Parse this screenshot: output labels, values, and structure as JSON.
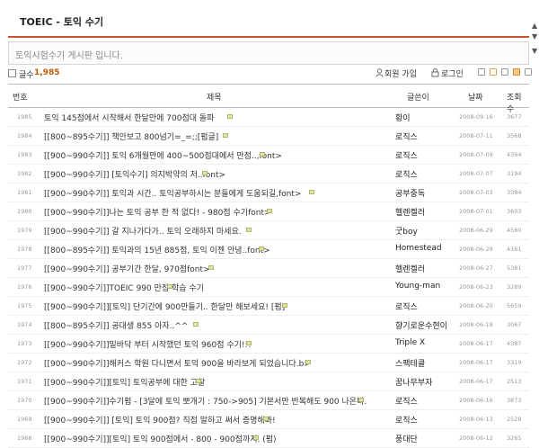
{
  "board": {
    "title": "TOEIC - 토익 수기",
    "description": "토익시험수기 게시판 입니다.",
    "count_label": "글수",
    "count_value": "1,985",
    "join_label": "회원 가입",
    "login_label": "로그인"
  },
  "header": {
    "no": "번호",
    "title": "제목",
    "author": "글쓴이",
    "date": "날짜",
    "views": "조회 수"
  },
  "rows": [
    {
      "no": "1985",
      "title": "토익 145점에서 시작해서 한달만에 700점대 돌파",
      "author": "황이",
      "date": "2008-09-16",
      "views": "3677"
    },
    {
      "no": "1984",
      "title": "[[800~895수기]] 책안보고 800넘기=_=;;[펌글]",
      "author": "로직스",
      "date": "2008-07-11",
      "views": "3568"
    },
    {
      "no": "1983",
      "title": "[[900~990수기]] 토익 6개월만에 400~500점대에서 만점..,font>",
      "author": "로직스",
      "date": "2008-07-09",
      "views": "4394"
    },
    {
      "no": "1982",
      "title": "[[900~990수기]] [토익수기] 의지박약의 저..font>",
      "author": "로직스",
      "date": "2008-07-07",
      "views": "3194"
    },
    {
      "no": "1981",
      "title": "[[900~990수기]] 토익과 시간.. 토익공부하시는 분들에게 도움되길,font>",
      "author": "공부중독",
      "date": "2008-07-03",
      "views": "3384"
    },
    {
      "no": "1980",
      "title": "[[900~990수기]]나는 토익 공부 한 적 없다! - 980점 수기font>",
      "author": "헬렌켈러",
      "date": "2008-07-01",
      "views": "3603"
    },
    {
      "no": "1979",
      "title": "[[900~990수기]] 갈 지나가다가.. 토익 오래하지 마세요.",
      "author": "굿boy",
      "date": "2008-06-29",
      "views": "4560"
    },
    {
      "no": "1978",
      "title": "[[800~895수기]] 토익과의 15년 885점, 토익 이젠 안녕..font>",
      "author": "Homestead",
      "date": "2008-06-29",
      "views": "4161"
    },
    {
      "no": "1977",
      "title": "[[900~990수기]] 공부기간 한달, 970점font>",
      "author": "헬렌켈러",
      "date": "2008-06-27",
      "views": "5381"
    },
    {
      "no": "1976",
      "title": "[[900~990수기]]TOEIC 990 만점 학습 수기",
      "author": "Young-man",
      "date": "2008-06-23",
      "views": "3289"
    },
    {
      "no": "1975",
      "title": "[[900~990수기]][토익] 단기간에 900만들기.. 한달만 해보세요! [펌]",
      "author": "로직스",
      "date": "2008-06-20",
      "views": "5659"
    },
    {
      "no": "1974",
      "title": "[[800~895수기]] 공대생 855 아자..^^",
      "author": "향기로운수현이",
      "date": "2008-06-18",
      "views": "3067"
    },
    {
      "no": "1973",
      "title": "[[900~990수기]]밑바닥 부터 시작했던 토익 960점 수기!!!",
      "author": "Triple X",
      "date": "2008-06-17",
      "views": "4387"
    },
    {
      "no": "1972",
      "title": "[[900~990수기]]해커스 학원 다니면서 토익 900을 바라보게 되었습니다.b>",
      "author": "스팩테클",
      "date": "2008-06-17",
      "views": "3319"
    },
    {
      "no": "1971",
      "title": "[[900~990수기]][토익] 토익공부에 대한 고찰",
      "author": "꿈나무부자",
      "date": "2008-06-17",
      "views": "2513"
    },
    {
      "no": "1970",
      "title": "[[900~990수기]]수기펌 - [3달에 토익 뽀개기 : 750->905] 기본서만 반복해도 900 나온다.",
      "author": "로직스",
      "date": "2008-06-16",
      "views": "3873"
    },
    {
      "no": "1969",
      "title": "[[900~990수기]] [토익] 토익 900점? 직접 말하고 써서 증명해봐!",
      "author": "로직스",
      "date": "2008-06-13",
      "views": "2528"
    },
    {
      "no": "1968",
      "title": "[[900~990수기]][토익] 토익 900점에서 - 800 - 900점까지. (펌)",
      "author": "풍대단",
      "date": "2008-06-12",
      "views": "3265"
    }
  ],
  "colors": {
    "accent": "#c8502a",
    "count": "#c05a00"
  }
}
